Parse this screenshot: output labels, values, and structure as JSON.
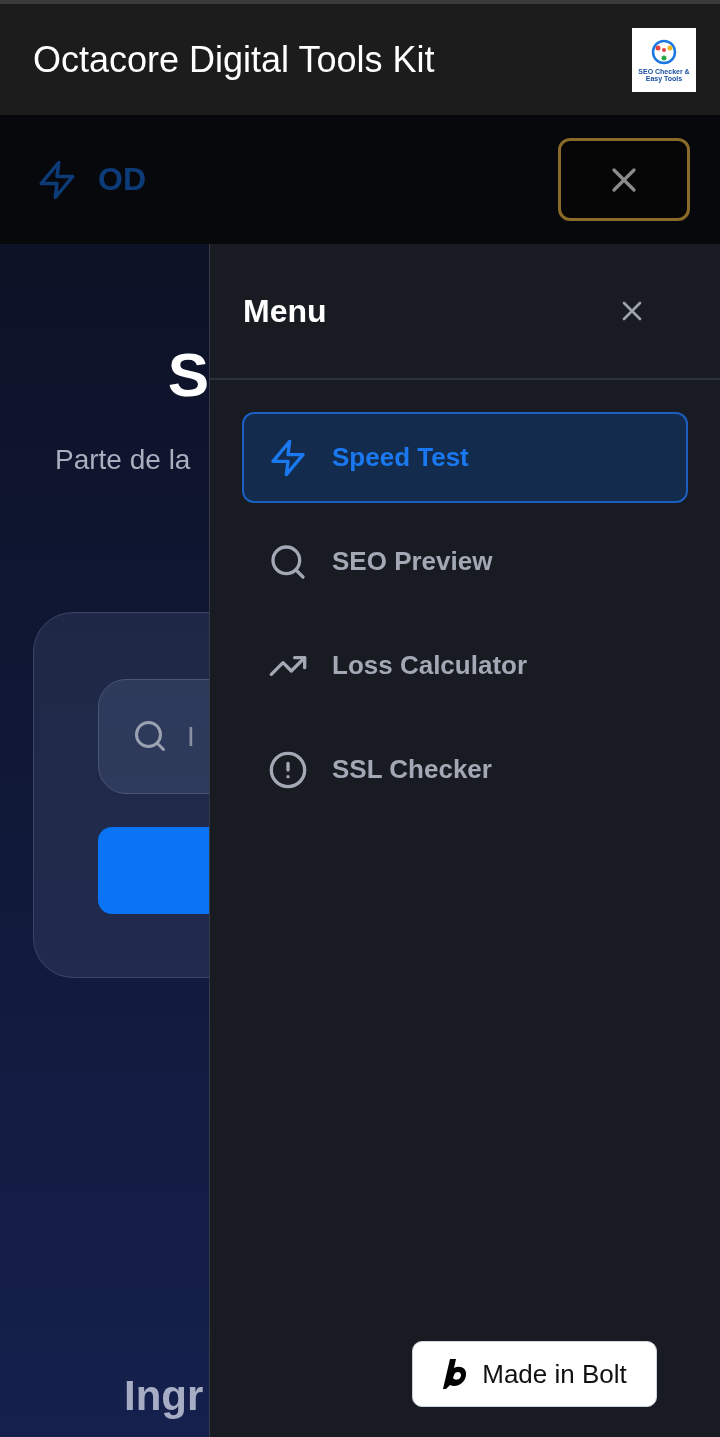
{
  "app_bar": {
    "title": "Octacore Digital Tools Kit",
    "logo_text": "SEO Checker & Easy Tools"
  },
  "nav": {
    "brand": "OD"
  },
  "page": {
    "heading": "S",
    "subtitle": "Parte de la",
    "search": {
      "placeholder": "I"
    },
    "footer_heading": "Ingr"
  },
  "menu": {
    "title": "Menu",
    "items": [
      {
        "label": "Speed Test",
        "kind": "bolt",
        "selected": true
      },
      {
        "label": "SEO Preview",
        "kind": "search",
        "selected": false
      },
      {
        "label": "Loss Calculator",
        "kind": "trend",
        "selected": false
      },
      {
        "label": "SSL Checker",
        "kind": "alert",
        "selected": false
      }
    ]
  },
  "badge": {
    "label": "Made in Bolt"
  }
}
